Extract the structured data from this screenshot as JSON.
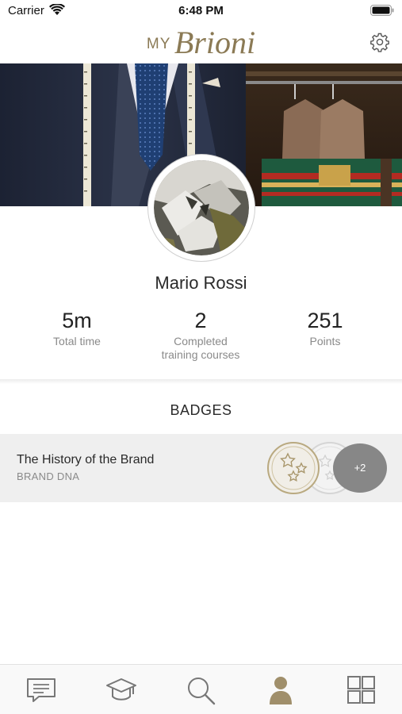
{
  "status_bar": {
    "carrier": "Carrier",
    "time": "6:48 PM"
  },
  "header": {
    "logo_prefix": "MY",
    "logo_name": "Brioni"
  },
  "profile": {
    "name": "Mario Rossi"
  },
  "stats": [
    {
      "value": "5m",
      "label": "Total time"
    },
    {
      "value": "2",
      "label": "Completed training courses"
    },
    {
      "value": "251",
      "label": "Points"
    }
  ],
  "badges": {
    "title": "BADGES",
    "items": [
      {
        "title": "The History of the Brand",
        "subtitle": "BRAND DNA",
        "more_count": "+2"
      }
    ]
  },
  "tab_bar": {
    "active": "profile",
    "active_color": "#a08f6b",
    "icons": [
      "chat-icon",
      "graduation-cap-icon",
      "search-icon",
      "profile-icon",
      "grid-icon"
    ]
  },
  "colors": {
    "accent": "#8b7a55",
    "muted_text": "#8a8a8a",
    "row_background": "#efefef"
  }
}
